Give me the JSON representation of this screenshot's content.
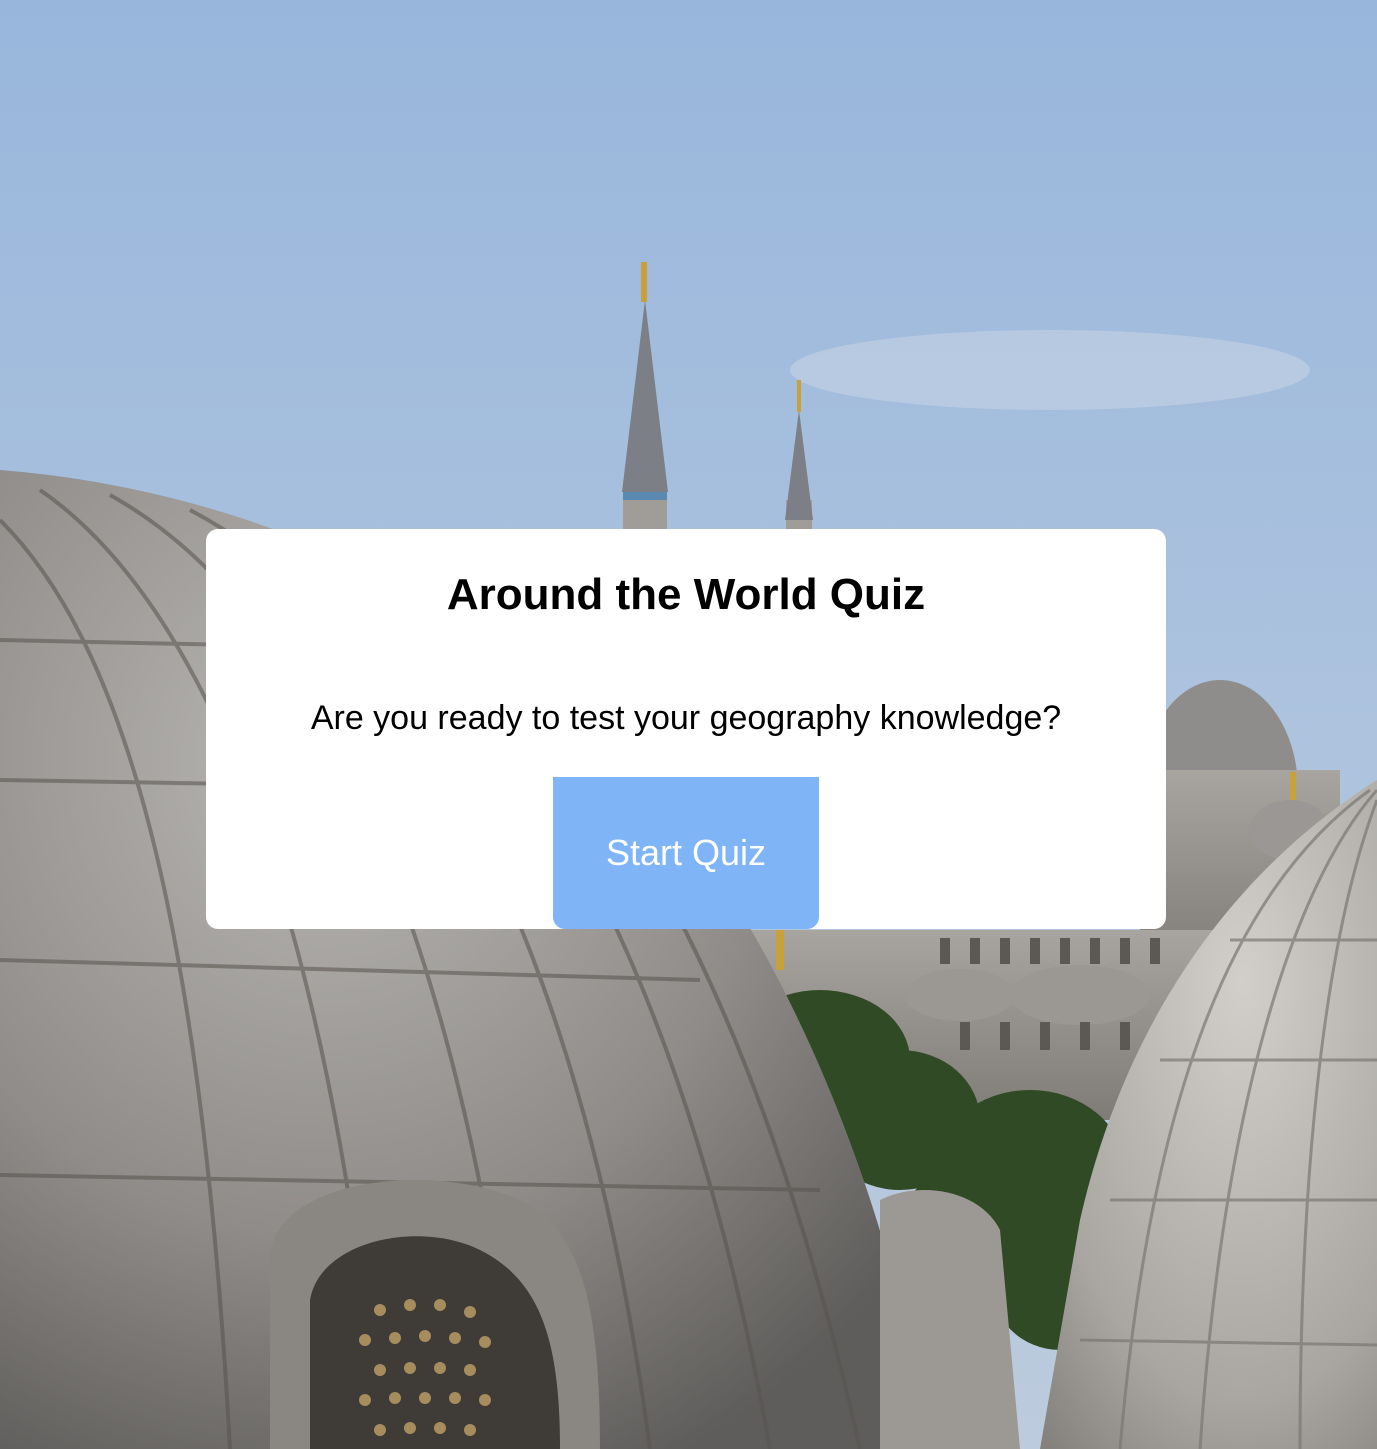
{
  "quiz": {
    "title": "Around the World Quiz",
    "prompt": "Are you ready to test your geography knowledge?",
    "start_button_label": "Start Quiz"
  },
  "colors": {
    "card_background": "#ffffff",
    "button_background": "#7fb4f7",
    "button_text": "#ffffff",
    "sky": "#a6bfdc"
  },
  "background_image": {
    "subject": "mosque-domes-and-minarets-photo"
  }
}
